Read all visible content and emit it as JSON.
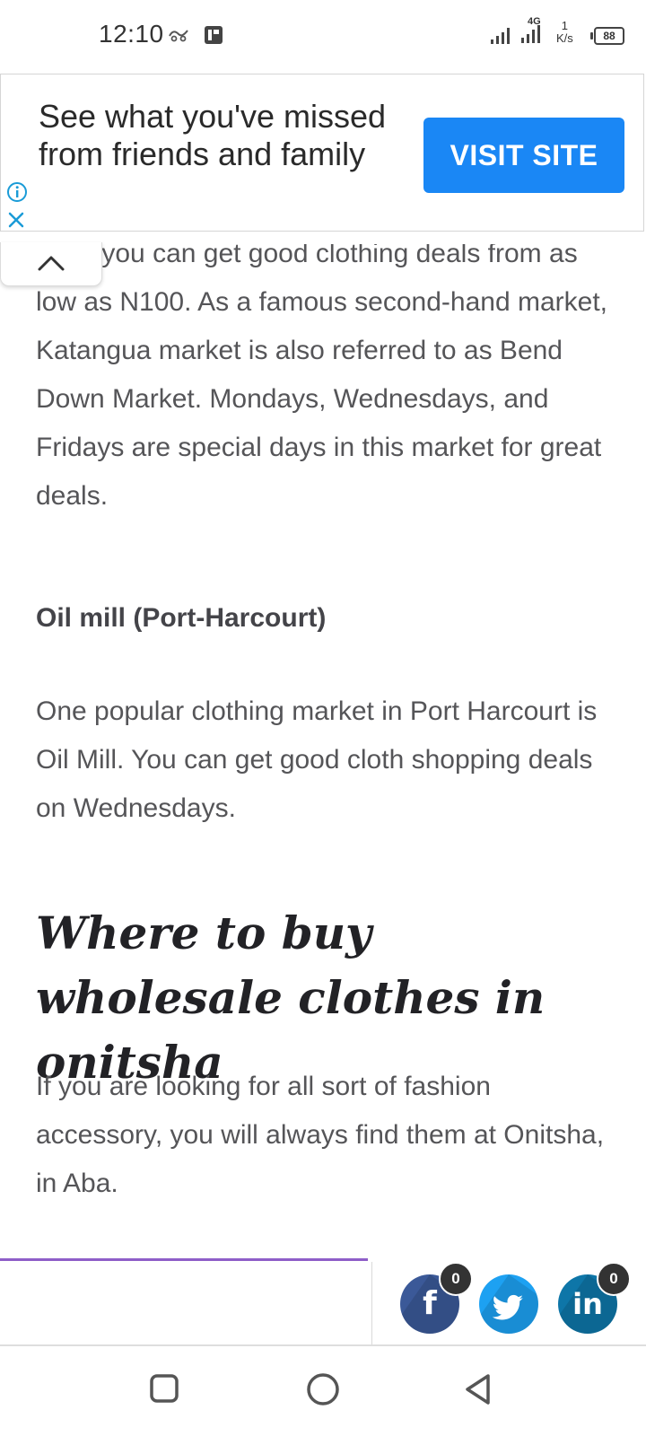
{
  "status_bar": {
    "time": "12:10",
    "network": "4G",
    "speed_value": "1",
    "speed_unit": "K/s",
    "battery": "88"
  },
  "ad": {
    "text": "See what you've missed from friends and family",
    "button_label": "VISIT SITE",
    "button_color": "#1a87f5"
  },
  "article": {
    "intro_partial": "Here you can get good clothing deals from as low as N100. As a famous second-hand market, Katangua market is also referred to as Bend Down Market. Mondays, Wednesdays, and Fridays are special days in this market for great deals.",
    "subheading": "Oil mill (Port-Harcourt)",
    "oil_mill_paragraph": "One popular clothing market in Port Harcourt is Oil Mill. You can get good cloth shopping deals on Wednesdays.",
    "section_heading": "Where to buy wholesale clothes in onitsha",
    "onitsha_paragraph": "If you are looking for all sort of fashion accessory, you will always find them at Onitsha, in Aba."
  },
  "share_bar": {
    "read_progress": 0.57,
    "progress_color": "#8e5ec8",
    "facebook": {
      "icon": "facebook-icon",
      "count": "0",
      "color": "#3b5998"
    },
    "twitter": {
      "icon": "twitter-icon",
      "color": "#1da1f2"
    },
    "linkedin": {
      "icon": "linkedin-icon",
      "count": "0",
      "color": "#0e76a8"
    }
  },
  "nav_bar": {
    "recents": "square-icon",
    "home": "circle-icon",
    "back": "triangle-back-icon"
  }
}
